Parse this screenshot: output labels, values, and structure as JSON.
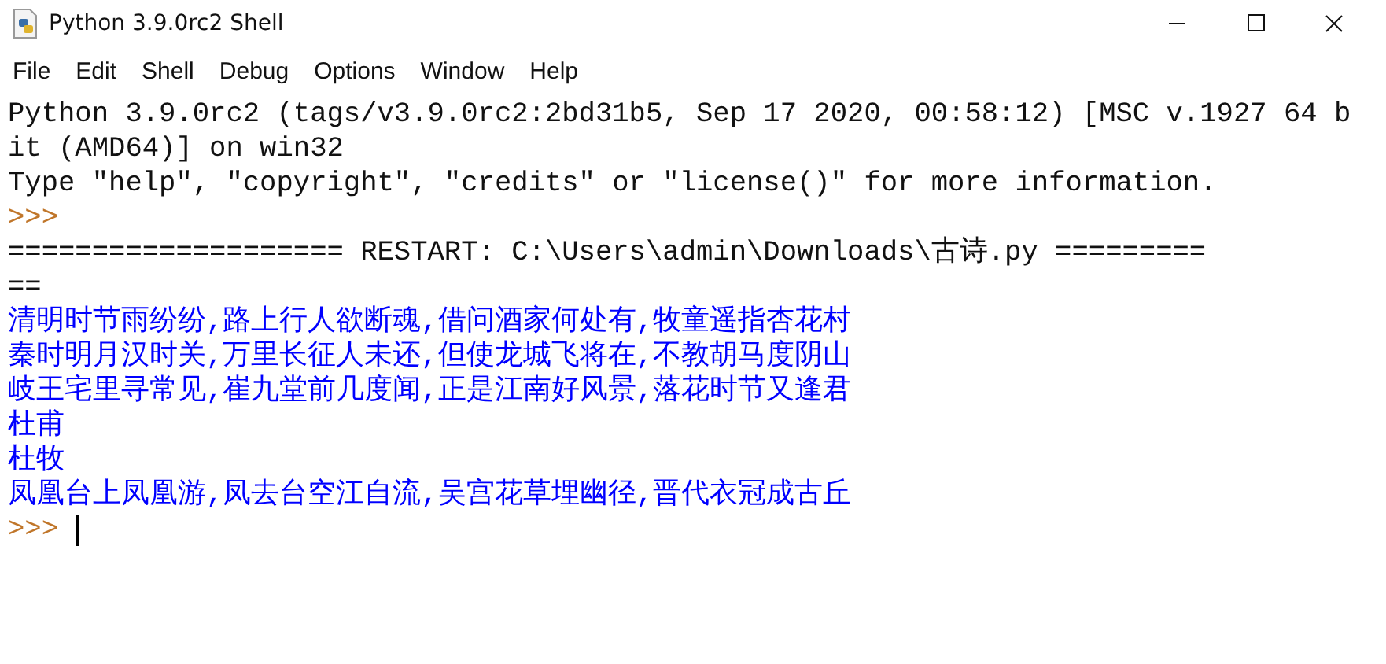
{
  "window": {
    "title": "Python 3.9.0rc2 Shell"
  },
  "menu": [
    "File",
    "Edit",
    "Shell",
    "Debug",
    "Options",
    "Window",
    "Help"
  ],
  "lines": [
    {
      "kind": "output",
      "text": "Python 3.9.0rc2 (tags/v3.9.0rc2:2bd31b5, Sep 17 2020, 00:58:12) [MSC v.1927 64 b"
    },
    {
      "kind": "output",
      "text": "it (AMD64)] on win32"
    },
    {
      "kind": "output",
      "text": "Type \"help\", \"copyright\", \"credits\" or \"license()\" for more information."
    },
    {
      "kind": "prompt",
      "text": ">>>"
    },
    {
      "kind": "output",
      "text": "==================== RESTART: C:\\Users\\admin\\Downloads\\古诗.py ========="
    },
    {
      "kind": "output",
      "text": "=="
    },
    {
      "kind": "stdout",
      "text": "清明时节雨纷纷,路上行人欲断魂,借问酒家何处有,牧童遥指杏花村"
    },
    {
      "kind": "stdout",
      "text": "秦时明月汉时关,万里长征人未还,但使龙城飞将在,不教胡马度阴山"
    },
    {
      "kind": "stdout",
      "text": "岐王宅里寻常见,崔九堂前几度闻,正是江南好风景,落花时节又逢君"
    },
    {
      "kind": "stdout",
      "text": "杜甫"
    },
    {
      "kind": "stdout",
      "text": "杜牧"
    },
    {
      "kind": "stdout",
      "text": "凤凰台上凤凰游,凤去台空江自流,吴宫花草埋幽径,晋代衣冠成古丘"
    },
    {
      "kind": "prompt",
      "text": ">>>",
      "cursor": true
    }
  ]
}
